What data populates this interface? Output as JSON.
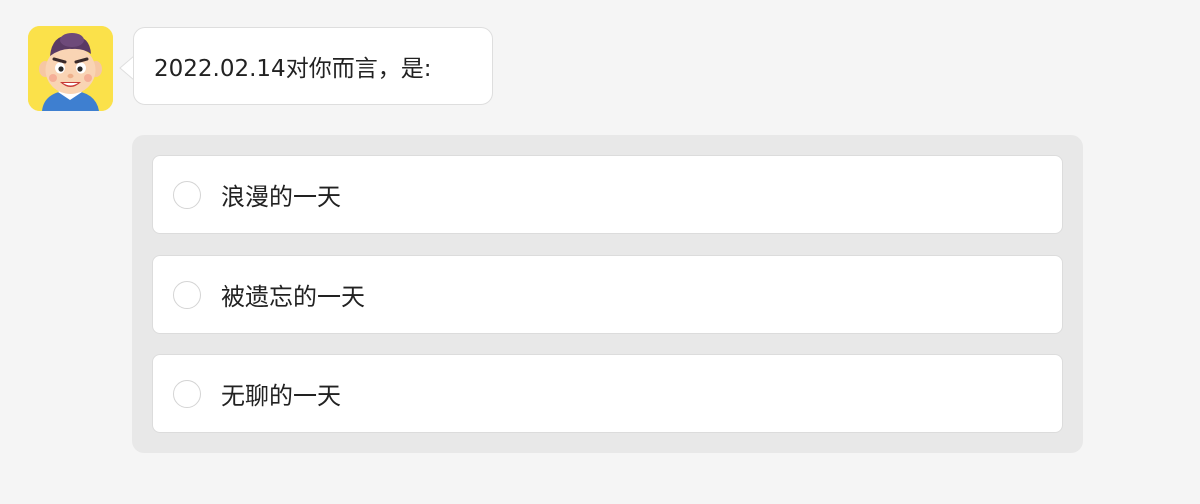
{
  "question": {
    "avatar": "cartoon-boy-avatar",
    "text": "2022.02.14对你而言，是:"
  },
  "options": [
    {
      "label": "浪漫的一天",
      "selected": false
    },
    {
      "label": "被遗忘的一天",
      "selected": false
    },
    {
      "label": "无聊的一天",
      "selected": false
    }
  ],
  "colors": {
    "page_background": "#f5f5f5",
    "panel_background": "#e8e8e8",
    "card_background": "#ffffff",
    "avatar_background": "#fbe14a"
  }
}
